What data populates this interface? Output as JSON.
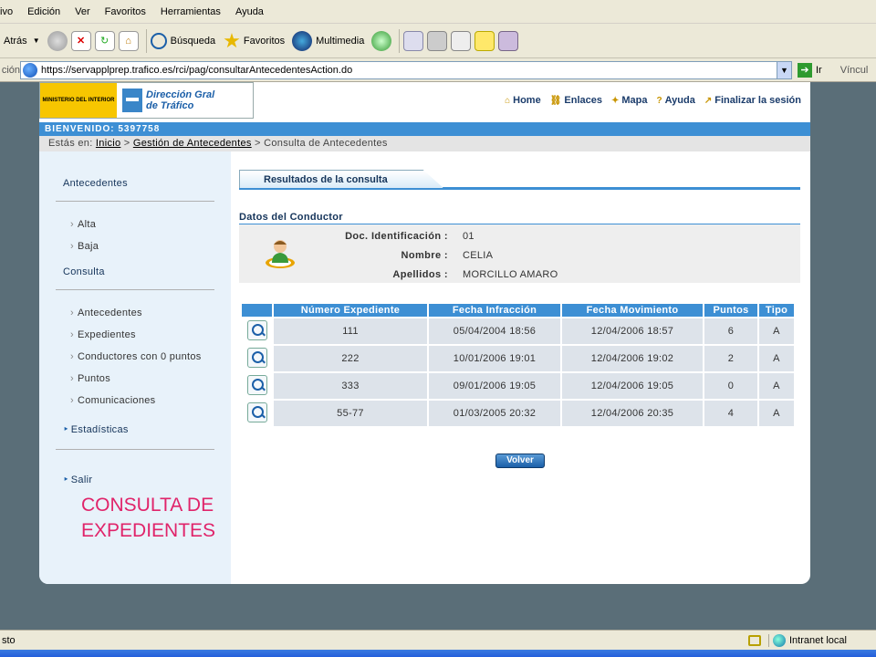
{
  "browser": {
    "menu": [
      "ivo",
      "Edición",
      "Ver",
      "Favoritos",
      "Herramientas",
      "Ayuda"
    ],
    "toolbar": {
      "back": "Atrás",
      "search": "Búsqueda",
      "favorites": "Favoritos",
      "multimedia": "Multimedia"
    },
    "address": {
      "label": "ción",
      "url": "https://servapplprep.trafico.es/rci/pag/consultarAntecedentesAction.do",
      "go": "Ir",
      "links": "Víncul"
    },
    "status": {
      "left": "sto",
      "zone": "Intranet local"
    }
  },
  "header": {
    "logo_left": "MINISTERIO DEL INTERIOR",
    "logo_right_line1": "Dirección Gral",
    "logo_right_line2": "de Tráfico",
    "nav": [
      "Home",
      "Enlaces",
      "Mapa",
      "Ayuda",
      "Finalizar la sesión"
    ]
  },
  "welcome": "BIENVENIDO: 5397758",
  "breadcrumb": {
    "prefix": "Estás en:",
    "home": "Inicio",
    "section": "Gestión de Antecedentes",
    "current": "Consulta de Antecedentes"
  },
  "sidebar": {
    "antecedentes": "Antecedentes",
    "alta": "Alta",
    "baja": "Baja",
    "consulta": "Consulta",
    "items": [
      "Antecedentes",
      "Expedientes",
      "Conductores con 0 puntos",
      "Puntos",
      "Comunicaciones"
    ],
    "estadisticas": "Estadísticas",
    "salir": "Salir"
  },
  "overlay_text": {
    "line1": "CONSULTA DE",
    "line2": "EXPEDIENTES"
  },
  "tab": "Resultados de la consulta",
  "conductor": {
    "title": "Datos del Conductor",
    "doc_label": "Doc. Identificación :",
    "doc_value": "01",
    "name_label": "Nombre :",
    "name_value": "CELIA",
    "surname_label": "Apellidos :",
    "surname_value": "MORCILLO AMARO"
  },
  "table": {
    "headers": [
      "Número Expediente",
      "Fecha Infracción",
      "Fecha Movimiento",
      "Puntos",
      "Tipo"
    ],
    "rows": [
      [
        "111",
        "05/04/2004 18:56",
        "12/04/2006 18:57",
        "6",
        "A"
      ],
      [
        "222",
        "10/01/2006 19:01",
        "12/04/2006 19:02",
        "2",
        "A"
      ],
      [
        "333",
        "09/01/2006 19:05",
        "12/04/2006 19:05",
        "0",
        "A"
      ],
      [
        "55-77",
        "01/03/2005 20:32",
        "12/04/2006 20:35",
        "4",
        "A"
      ]
    ]
  },
  "volver": "Volver"
}
